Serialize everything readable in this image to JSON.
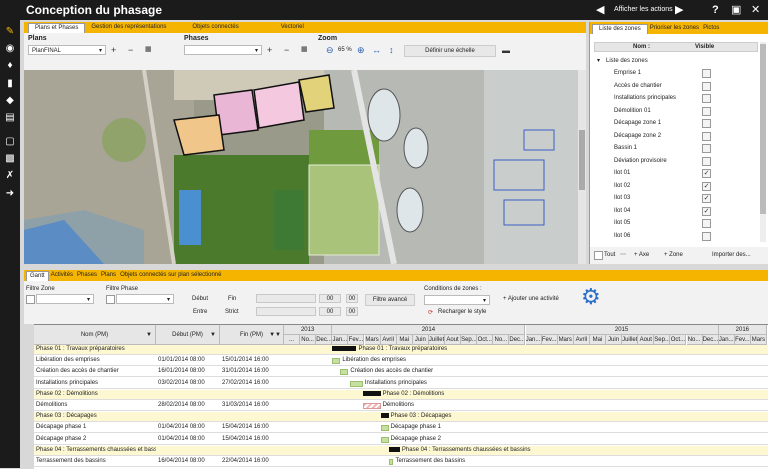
{
  "app": {
    "title": "Conception du phasage",
    "show_actions": "Afficher les actions"
  },
  "top_tabs": [
    "Plans et Phases",
    "Gestion des représentations",
    "Objets connectés",
    "Vectoriel"
  ],
  "plans": {
    "label": "Plans",
    "value": "PlanFINAL"
  },
  "phases": {
    "label": "Phases",
    "value": ""
  },
  "zoom": {
    "label": "Zoom",
    "value": "65 %"
  },
  "scale_button": "Définir une échelle",
  "zones_panel": {
    "tabs": [
      "Liste des zones",
      "Prioriser les zones",
      "Pictos"
    ],
    "col_name": "Nom :",
    "col_visible": "Visible",
    "group": "Liste des zones",
    "items": [
      {
        "name": "Emprise 1",
        "visible": false
      },
      {
        "name": "Accès de chantier",
        "visible": false
      },
      {
        "name": "Installations principales",
        "visible": false
      },
      {
        "name": "Démolition 01",
        "visible": false
      },
      {
        "name": "Décapage zone 1",
        "visible": false
      },
      {
        "name": "Décapage zone 2",
        "visible": false
      },
      {
        "name": "Bassin 1",
        "visible": false
      },
      {
        "name": "Déviation provisoire",
        "visible": false
      },
      {
        "name": "Ilot 01",
        "visible": true
      },
      {
        "name": "Ilot 02",
        "visible": true
      },
      {
        "name": "Ilot 03",
        "visible": true
      },
      {
        "name": "Ilot 04",
        "visible": true
      },
      {
        "name": "Ilot 05",
        "visible": false
      },
      {
        "name": "Ilot 06",
        "visible": false
      }
    ],
    "footer": {
      "all": "Tout",
      "add_axis": "+ Axe",
      "add_zone": "+ Zone",
      "import": "Importer des..."
    }
  },
  "bottom_tabs": [
    "Gantt",
    "Activités",
    "Phases",
    "Plans",
    "Objets connectés sur plan sélectionné"
  ],
  "filters": {
    "zone_label": "Filtre Zone",
    "phase_label": "Filtre Phase",
    "debut": "Début",
    "fin": "Fin",
    "entre": "Entre",
    "strict": "Strict",
    "time_placeholder": "00",
    "advanced": "Filtre avancé",
    "zone_conditions": "Conditions de zones :",
    "add_activity": "+ Ajouter une activité",
    "reload_style": "Recharger le style"
  },
  "gantt": {
    "headers": {
      "name": "Nom (PM)",
      "start": "Début (PM)",
      "end": "Fin (PM)"
    },
    "years": [
      "2013",
      "2014",
      "2015",
      "2016"
    ],
    "months": [
      "...",
      "No...",
      "Dec...",
      "Jan...",
      "Fev...",
      "Mars",
      "Avril",
      "Mai",
      "Juin",
      "Juillet",
      "Aout",
      "Sep...",
      "Oct...",
      "No...",
      "Dec...",
      "Jan...",
      "Fev...",
      "Mars",
      "Avril",
      "Mai",
      "Juin",
      "Juillet",
      "Aout",
      "Sep...",
      "Oct...",
      "No...",
      "Dec...",
      "Jan...",
      "Fev...",
      "Mars"
    ],
    "rows": [
      {
        "name": "Phase 01 : Travaux préparatoires",
        "start": "",
        "end": "",
        "phase": true,
        "bar": {
          "from": 0,
          "to": 1.5
        },
        "label": "Phase 01 : Travaux préparatoires"
      },
      {
        "name": "Libération des emprises",
        "start": "01/01/2014 08:00",
        "end": "15/01/2014 16:00",
        "phase": false,
        "bar": {
          "from": 0,
          "to": 0.5
        },
        "label": "Libération des emprises"
      },
      {
        "name": "Création des accès de chantier",
        "start": "16/01/2014 08:00",
        "end": "31/01/2014 16:00",
        "phase": false,
        "bar": {
          "from": 0.5,
          "to": 1
        },
        "label": "Création des accès de chantier"
      },
      {
        "name": "Installations principales",
        "start": "03/02/2014 08:00",
        "end": "27/02/2014 16:00",
        "phase": false,
        "bar": {
          "from": 1.1,
          "to": 1.9
        },
        "label": "Installations principales"
      },
      {
        "name": "Phase 02 : Démolitions",
        "start": "",
        "end": "",
        "phase": true,
        "bar": {
          "from": 1.9,
          "to": 3
        },
        "label": "Phase 02 : Démolitions"
      },
      {
        "name": "Démolitions",
        "start": "28/02/2014 08:00",
        "end": "31/03/2014 16:00",
        "phase": false,
        "bar": {
          "from": 1.9,
          "to": 3
        },
        "label": "Démolitions",
        "hatch": true
      },
      {
        "name": "Phase 03 : Décapages",
        "start": "",
        "end": "",
        "phase": true,
        "bar": {
          "from": 3,
          "to": 3.5
        },
        "label": "Phase 03 : Décapages"
      },
      {
        "name": "Décapage phase 1",
        "start": "01/04/2014 08:00",
        "end": "15/04/2014 16:00",
        "phase": false,
        "bar": {
          "from": 3,
          "to": 3.5
        },
        "label": "Décapage phase 1"
      },
      {
        "name": "Décapage phase 2",
        "start": "01/04/2014 08:00",
        "end": "15/04/2014 16:00",
        "phase": false,
        "bar": {
          "from": 3,
          "to": 3.5
        },
        "label": "Décapage phase 2"
      },
      {
        "name": "Phase 04 : Terrassements chaussées et bass...",
        "start": "",
        "end": "",
        "phase": true,
        "bar": {
          "from": 3.5,
          "to": 4.2
        },
        "label": "Phase 04 : Terrassements chaussées et bassins"
      },
      {
        "name": "Terrassement des bassins",
        "start": "16/04/2014 08:00",
        "end": "22/04/2014 16:00",
        "phase": false,
        "bar": {
          "from": 3.5,
          "to": 3.8
        },
        "label": "Terrassement des bassins"
      }
    ]
  },
  "colors": {
    "accent": "#f5b400",
    "dark": "#1b1b1b"
  }
}
